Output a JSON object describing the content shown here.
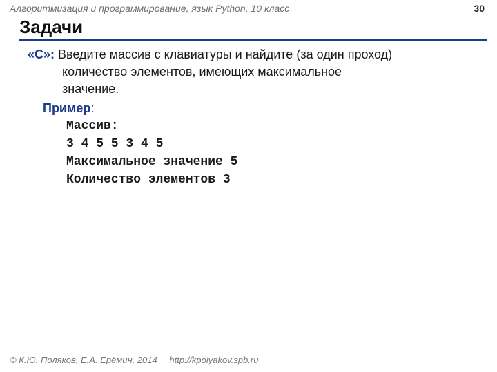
{
  "header": {
    "course": "Алгоритмизация и программирование, язык Python, 10 класс",
    "page": "30"
  },
  "title": "Задачи",
  "task": {
    "marker": "«C»:",
    "line1": "Введите массив с клавиатуры и найдите (за один проход)",
    "line2": "количество элементов, имеющих максимальное",
    "line3": "значение."
  },
  "example": {
    "label": "Пример",
    "colon": ":",
    "lines": [
      "Массив:",
      "3 4 5 5 3 4 5",
      "Максимальное значение 5",
      "Количество элементов 3"
    ]
  },
  "footer": {
    "copyright": "© К.Ю. Поляков, Е.А. Ерёмин, 2014",
    "url": "http://kpolyakov.spb.ru"
  }
}
